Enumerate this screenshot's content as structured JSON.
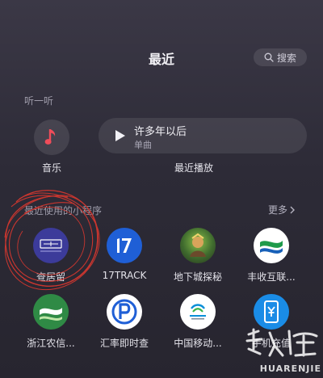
{
  "header": {
    "title": "最近",
    "search_label": "搜索"
  },
  "listen": {
    "section_title": "听一听",
    "music_label": "音乐",
    "recent": {
      "song": "许多年以后",
      "subtitle": "单曲",
      "label": "最近播放"
    }
  },
  "mini_programs": {
    "section_title": "最近使用的小程序",
    "more_label": "更多",
    "apps": [
      {
        "name": "查居留",
        "icon": "chajuliu-logo-icon",
        "color": "#3c3b9a"
      },
      {
        "name": "17TRACK",
        "icon": "17track-logo-icon",
        "color": "#1f5fd6"
      },
      {
        "name": "地下城探秘",
        "icon": "dungeon-game-icon",
        "color": "#4a7a3a"
      },
      {
        "name": "丰收互联...",
        "icon": "fengshou-logo-icon",
        "color": "#ffffff"
      },
      {
        "name": "浙江农信...",
        "icon": "zhejiang-rural-credit-icon",
        "color": "#2f8a45"
      },
      {
        "name": "汇率即时查",
        "icon": "exchange-rate-icon",
        "color": "#ffffff"
      },
      {
        "name": "中国移动...",
        "icon": "china-mobile-icon",
        "color": "#ffffff"
      },
      {
        "name": "手机充值",
        "icon": "phone-recharge-icon",
        "color": "#1a8ce6"
      }
    ]
  },
  "watermark": {
    "logo_text": "华人街",
    "brand": "HUARENJIE"
  }
}
